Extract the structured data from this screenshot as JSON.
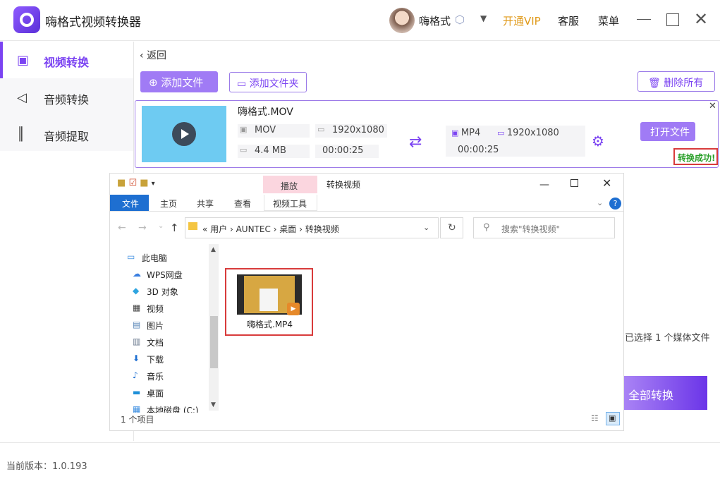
{
  "app": {
    "title": "嗨格式视频转换器",
    "username": "嗨格式",
    "vip": "开通VIP",
    "service": "客服",
    "menu": "菜单",
    "version": "当前版本：1.0.193"
  },
  "sidebar": {
    "items": [
      {
        "label": "视频转换",
        "icon": "video-convert-icon",
        "active": true
      },
      {
        "label": "音频转换",
        "icon": "audio-convert-icon",
        "active": false
      },
      {
        "label": "音频提取",
        "icon": "audio-extract-icon",
        "active": false
      }
    ]
  },
  "toolbar": {
    "back": "返回",
    "add_file": "添加文件",
    "add_folder": "添加文件夹",
    "delete_all": "删除所有"
  },
  "file_card": {
    "name": "嗨格式.MOV",
    "input": {
      "format": "MOV",
      "resolution": "1920x1080",
      "size": "4.4 MB",
      "duration": "00:00:25"
    },
    "output": {
      "format": "MP4",
      "resolution": "1920x1080",
      "duration": "00:00:25"
    },
    "open_file": "打开文件",
    "status": "转换成功!"
  },
  "right_panel": {
    "selected": "已选择 1 个媒体文件",
    "convert_all": "全部转换"
  },
  "explorer": {
    "title": "转换视频",
    "context_tab": "播放",
    "tabs": [
      "文件",
      "主页",
      "共享",
      "查看"
    ],
    "video_tools": "视频工具",
    "address": "«  用户  ›  AUNTEC  ›  桌面  ›  转换视频",
    "search_placeholder": "搜索\"转换视频\"",
    "nav_items": [
      {
        "label": "此电脑",
        "icon": "this-pc-icon",
        "color": "#3b8ee0"
      },
      {
        "label": "WPS网盘",
        "icon": "cloud-icon",
        "color": "#3b7fe0"
      },
      {
        "label": "3D 对象",
        "icon": "cube-icon",
        "color": "#2ea4e0"
      },
      {
        "label": "视频",
        "icon": "film-icon",
        "color": "#444444"
      },
      {
        "label": "图片",
        "icon": "picture-icon",
        "color": "#5a87b8"
      },
      {
        "label": "文档",
        "icon": "document-icon",
        "color": "#6b7a8f"
      },
      {
        "label": "下载",
        "icon": "download-arrow-icon",
        "color": "#1e6fd1"
      },
      {
        "label": "音乐",
        "icon": "music-note-icon",
        "color": "#1e6fd1"
      },
      {
        "label": "桌面",
        "icon": "desktop-icon",
        "color": "#1e8fd8"
      },
      {
        "label": "本地磁盘 (C:)",
        "icon": "disk-icon",
        "color": "#3b8ee0"
      }
    ],
    "file": {
      "name": "嗨格式.MP4"
    },
    "status_count": "1 个项目"
  }
}
